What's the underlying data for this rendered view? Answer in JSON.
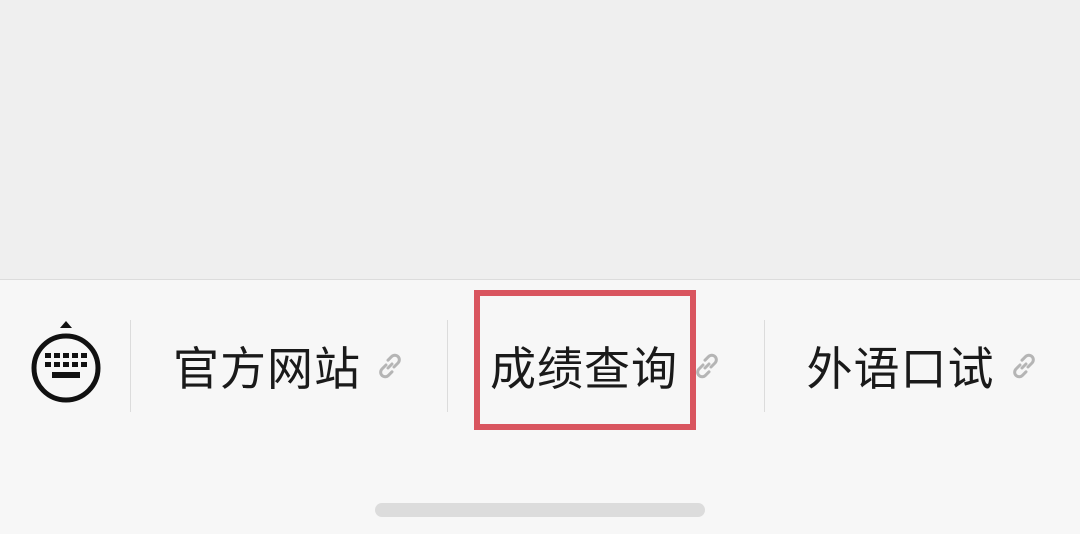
{
  "menu": {
    "items": [
      {
        "label": "官方网站",
        "icon": "link-icon"
      },
      {
        "label": "成绩查询",
        "icon": "link-icon"
      },
      {
        "label": "外语口试",
        "icon": "link-icon"
      }
    ],
    "toggle_icon": "keyboard-icon",
    "highlight_color": "#d9555f"
  }
}
